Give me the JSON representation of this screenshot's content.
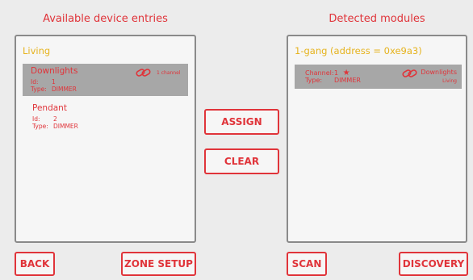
{
  "left_heading": "Available device entries",
  "right_heading": "Detected modules",
  "left_panel": {
    "group": "Living",
    "entries": [
      {
        "name": "Downlights",
        "id_label": "Id:",
        "id": "1",
        "type_label": "Type:",
        "type": "DIMMER",
        "link_text": "1 channel",
        "selected": true
      },
      {
        "name": "Pendant",
        "id_label": "Id:",
        "id": "2",
        "type_label": "Type:",
        "type": "DIMMER",
        "selected": false
      }
    ]
  },
  "right_panel": {
    "group": "1-gang (address = 0xe9a3)",
    "module": {
      "channel_label": "Channel:",
      "channel": "1",
      "star": "★",
      "type_label": "Type:",
      "type": "DIMMER",
      "linked_name": "Downlights",
      "linked_zone": "Living"
    }
  },
  "buttons": {
    "assign": "ASSIGN",
    "clear": "CLEAR",
    "back": "BACK",
    "zone_setup": "ZONE SETUP",
    "scan": "SCAN",
    "discovery": "DISCOVERY"
  },
  "colors": {
    "accent": "#e0343a",
    "group": "#e6b31e",
    "selected_bg": "#a7a7a7",
    "panel_border": "#8a8a8a"
  },
  "icons": {
    "link": "link-icon",
    "star": "star-icon"
  }
}
